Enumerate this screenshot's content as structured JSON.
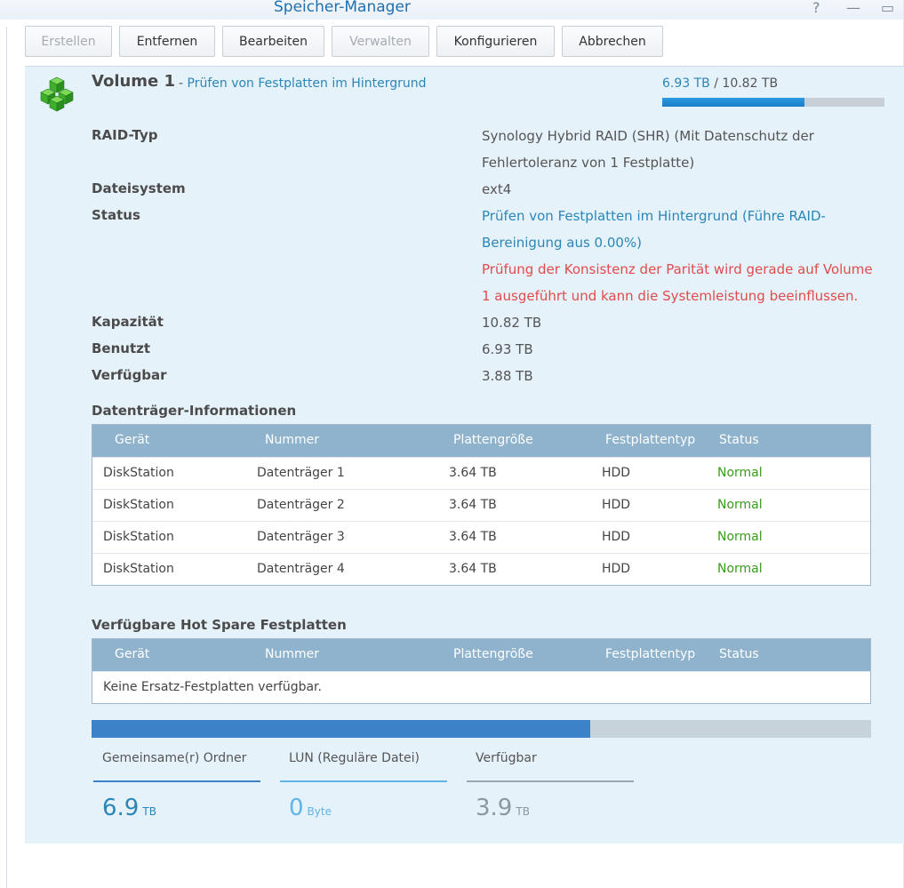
{
  "window": {
    "title": "Speicher-Manager",
    "help_glyph": "?",
    "minimize_glyph": "—",
    "maximize_glyph": "▭"
  },
  "toolbar": {
    "create": "Erstellen",
    "remove": "Entfernen",
    "edit": "Bearbeiten",
    "manage": "Verwalten",
    "configure": "Konfigurieren",
    "cancel": "Abbrechen"
  },
  "volume": {
    "name": "Volume 1",
    "dash": "-",
    "subtitle": "Prüfen von Festplatten im Hintergrund",
    "used": "6.93 TB",
    "separator": " / ",
    "total": "10.82 TB",
    "usage_fraction": 0.64,
    "icon": "green-cubes-icon"
  },
  "properties": {
    "raid_label": "RAID-Typ",
    "raid_value": "Synology Hybrid RAID (SHR) (Mit Datenschutz der Fehlertoleranz von 1 Festplatte)",
    "fs_label": "Dateisystem",
    "fs_value": "ext4",
    "status_label": "Status",
    "status_value": "Prüfen von Festplatten im Hintergrund (Führe RAID-Bereinigung aus 0.00%)",
    "status_warning": "Prüfung der Konsistenz der Parität wird gerade auf Volume 1 ausgeführt und kann die Systemleistung beeinflussen.",
    "capacity_label": "Kapazität",
    "capacity_value": "10.82 TB",
    "used_label": "Benutzt",
    "used_value": "6.93 TB",
    "available_label": "Verfügbar",
    "available_value": "3.88 TB"
  },
  "disks": {
    "title": "Datenträger-Informationen",
    "columns": [
      "Gerät",
      "Nummer",
      "Plattengröße",
      "Festplattentyp",
      "Status"
    ],
    "rows": [
      [
        "DiskStation",
        "Datenträger 1",
        "3.64 TB",
        "HDD",
        "Normal"
      ],
      [
        "DiskStation",
        "Datenträger 2",
        "3.64 TB",
        "HDD",
        "Normal"
      ],
      [
        "DiskStation",
        "Datenträger 3",
        "3.64 TB",
        "HDD",
        "Normal"
      ],
      [
        "DiskStation",
        "Datenträger 4",
        "3.64 TB",
        "HDD",
        "Normal"
      ]
    ]
  },
  "hotspare": {
    "title": "Verfügbare Hot Spare Festplatten",
    "columns": [
      "Gerät",
      "Nummer",
      "Plattengröße",
      "Festplattentyp",
      "Status"
    ],
    "empty": "Keine Ersatz-Festplatten verfügbar."
  },
  "allocation": {
    "used_fraction": 0.64,
    "shared_label": "Gemeinsame(r) Ordner",
    "shared_value": "6.9",
    "shared_unit": "TB",
    "lun_label": "LUN (Reguläre Datei)",
    "lun_value": "0",
    "lun_unit": "Byte",
    "free_label": "Verfügbar",
    "free_value": "3.9",
    "free_unit": "TB"
  },
  "colors": {
    "accent": "#2a86b8",
    "ok": "#3a9a1c",
    "warning": "#e04b4b",
    "panel": "#e6f2fa"
  }
}
